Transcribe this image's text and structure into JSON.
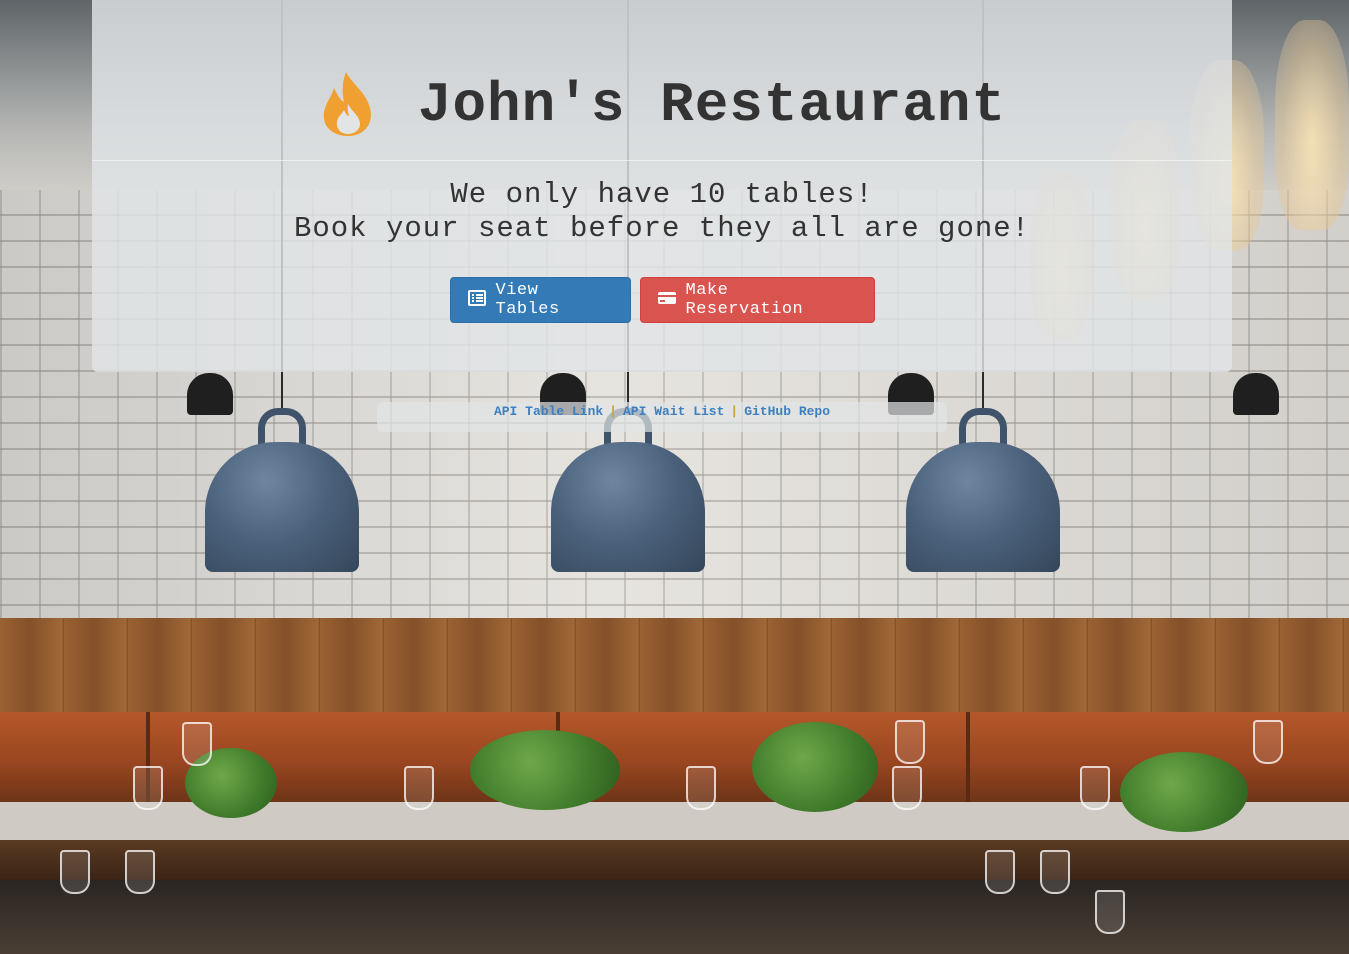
{
  "header": {
    "title": "John's Restaurant",
    "icon": "fire-icon"
  },
  "tagline": {
    "line1": "We only have 10 tables!",
    "line2": "Book your seat before they all are gone!"
  },
  "actions": {
    "view_tables": {
      "label": "View Tables",
      "icon": "list-icon"
    },
    "make_reservation": {
      "label": "Make Reservation",
      "icon": "credit-card-icon"
    }
  },
  "links": [
    {
      "label": "API Table Link"
    },
    {
      "label": "API Wait List"
    },
    {
      "label": "GitHub Repo"
    }
  ],
  "links_separator": "|",
  "colors": {
    "primary": "#337ab7",
    "danger": "#d9534f",
    "fire": "#f0a030",
    "link": "#3d7fbf",
    "separator": "#c9a03a"
  }
}
